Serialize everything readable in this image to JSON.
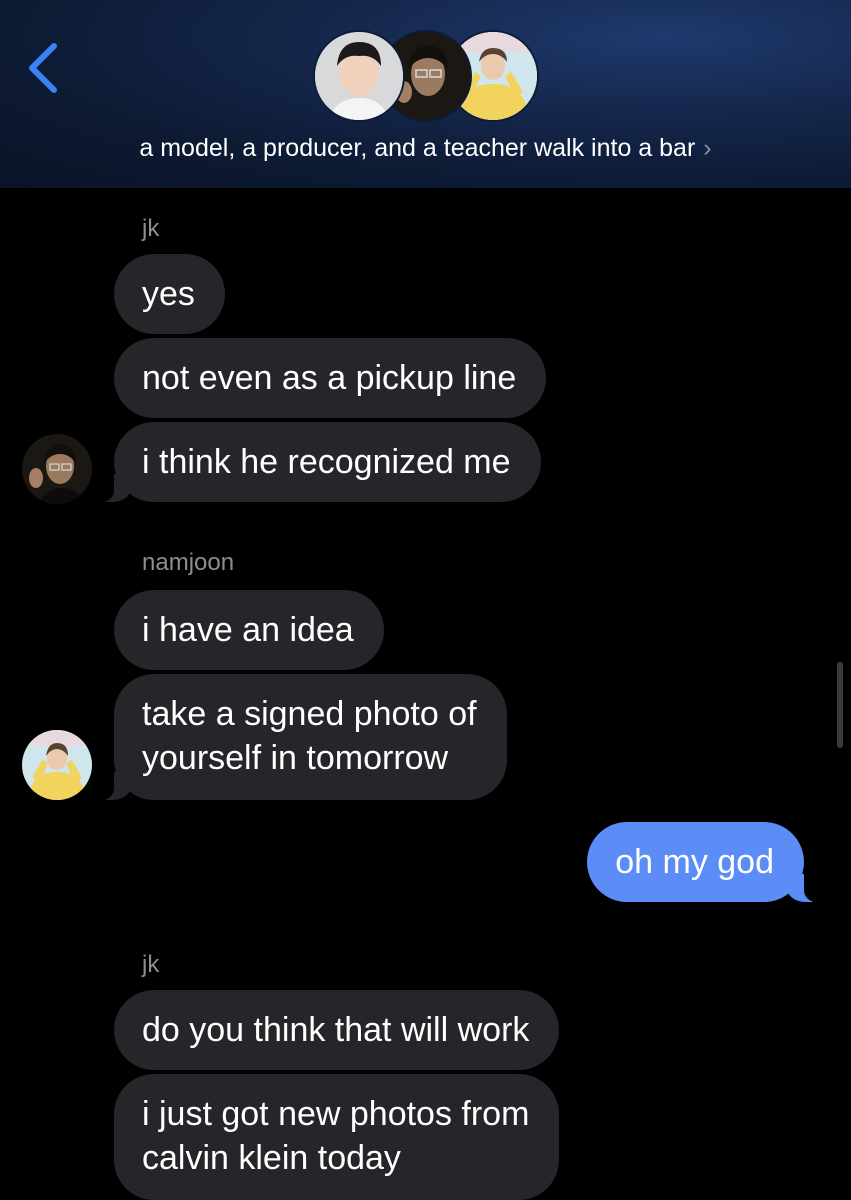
{
  "header": {
    "group_name": "a model, a producer, and a teacher walk into a bar",
    "chevron": "›",
    "avatars": [
      "group-member-1-avatar",
      "group-member-2-avatar",
      "group-member-3-avatar"
    ]
  },
  "messages": [
    {
      "sender": "jk"
    },
    {
      "text": "yes"
    },
    {
      "text": "not even as a pickup line"
    },
    {
      "text": "i think he recognized me"
    },
    {
      "sender": "namjoon"
    },
    {
      "text": "i have an idea"
    },
    {
      "line1": "take a signed photo of",
      "line2": "yourself in tomorrow"
    },
    {
      "text": "oh my god"
    },
    {
      "sender": "jk"
    },
    {
      "text": "do you think that will work"
    },
    {
      "line1": "i just got new photos from",
      "line2": "calvin klein today"
    }
  ],
  "colors": {
    "header_bg": "#15274c",
    "incoming_bubble": "#26252a",
    "outgoing_bubble": "#5c8df6",
    "sender_label": "#8d8d93",
    "back_arrow": "#3b82f6"
  }
}
